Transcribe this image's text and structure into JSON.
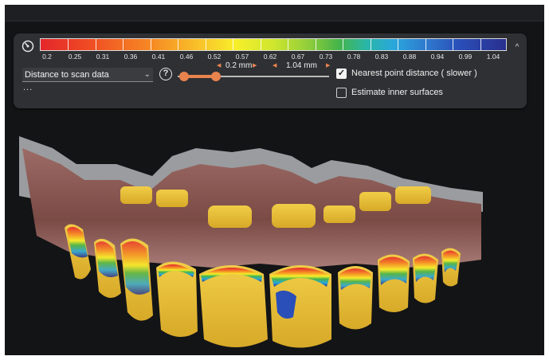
{
  "colorbar": {
    "icon": "gauge-icon",
    "ticks": [
      "0.2",
      "0.25",
      "0.31",
      "0.36",
      "0.41",
      "0.46",
      "0.52",
      "0.57",
      "0.62",
      "0.67",
      "0.73",
      "0.78",
      "0.83",
      "0.88",
      "0.94",
      "0.99",
      "1.04"
    ],
    "colors": [
      "#e4262c",
      "#f68b24",
      "#f7ef2a",
      "#8ccc3c",
      "#29a7dc",
      "#2a2f8e"
    ]
  },
  "controls": {
    "mode_select": "Distance to scan data",
    "help_label": "?",
    "min_value": "0.2 mm",
    "max_value": "1.04 mm",
    "range": {
      "min": 0.2,
      "max": 1.04
    },
    "nearest_point_label": "Nearest point distance ( slower )",
    "nearest_point_checked": true,
    "estimate_inner_label": "Estimate inner surfaces",
    "estimate_inner_checked": false,
    "more_label": "..."
  }
}
